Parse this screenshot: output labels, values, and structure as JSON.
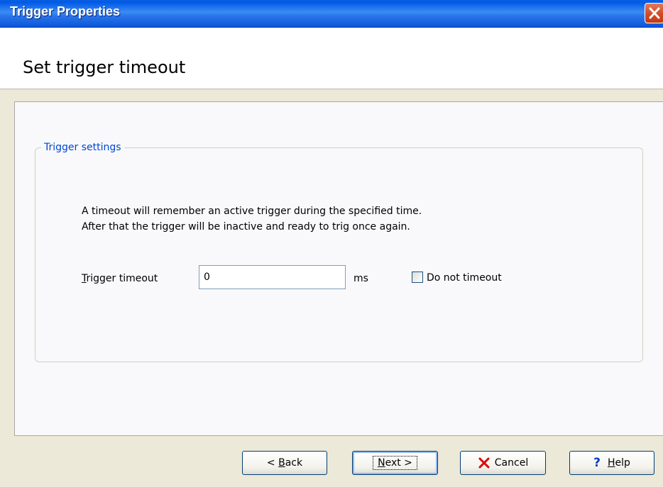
{
  "window": {
    "title": "Trigger Properties",
    "close_icon": "close-icon"
  },
  "header": {
    "heading": "Set trigger timeout"
  },
  "group": {
    "legend": "Trigger settings",
    "description_line1": "A timeout will remember an active trigger during the specified time.",
    "description_line2": "After that the trigger will be inactive and ready to trig once again.",
    "timeout_label_mnemonic": "T",
    "timeout_label_rest": "rigger timeout",
    "timeout_value": "0",
    "timeout_unit": "ms",
    "do_not_timeout_label": "Do not timeout",
    "do_not_timeout_checked": false
  },
  "buttons": {
    "back_prefix": "< ",
    "back_mnemonic": "B",
    "back_rest": "ack",
    "next_mnemonic": "N",
    "next_rest": "ext >",
    "cancel_label": "Cancel",
    "cancel_icon": "red-x-icon",
    "help_mnemonic": "H",
    "help_rest": "elp",
    "help_icon": "question-mark-icon"
  },
  "colors": {
    "titlebar": "#0058e6",
    "legend_text": "#0046d5",
    "cancel_icon": "#e00000",
    "help_icon": "#0040c0"
  }
}
